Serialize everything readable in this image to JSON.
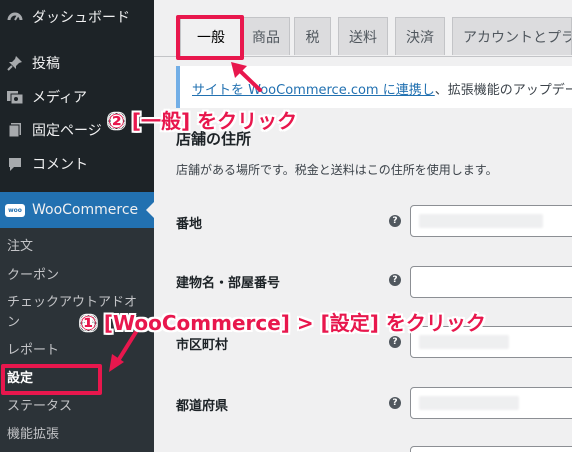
{
  "sidebar": {
    "items": [
      {
        "label": "ダッシュボード",
        "icon": "dashboard-icon"
      },
      {
        "label": "投稿",
        "icon": "pin-icon"
      },
      {
        "label": "メディア",
        "icon": "media-icon"
      },
      {
        "label": "固定ページ",
        "icon": "pages-icon"
      },
      {
        "label": "コメント",
        "icon": "comment-icon"
      }
    ],
    "woocommerce": {
      "label": "WooCommerce",
      "badge": "woo"
    },
    "submenu": [
      {
        "label": "注文"
      },
      {
        "label": "クーポン"
      },
      {
        "label": "チェックアウトアドオ"
      },
      {
        "label": "ン"
      },
      {
        "label": "レポート"
      },
      {
        "label": "設定"
      },
      {
        "label": "ステータス"
      },
      {
        "label": "機能拡張"
      }
    ]
  },
  "tabs": [
    {
      "label": "一般"
    },
    {
      "label": "商品"
    },
    {
      "label": "税"
    },
    {
      "label": "送料"
    },
    {
      "label": "決済"
    },
    {
      "label": "アカウントとプラ"
    }
  ],
  "notice": {
    "link_text": "サイトを WooCommerce.com に連携し",
    "rest_text": "、拡張機能のアップデート"
  },
  "section": {
    "title": "店舗の住所",
    "description": "店舗がある場所です。税金と送料はこの住所を使用します。"
  },
  "fields": [
    {
      "label": "番地",
      "help": "?"
    },
    {
      "label": "建物名・部屋番号",
      "help": "?"
    },
    {
      "label": "市区町村",
      "help": "?"
    },
    {
      "label": "都道府県",
      "help": "?"
    }
  ],
  "annotations": {
    "step2": "② [一般] をクリック",
    "step1": "① [WooCommerce] > [設定] をクリック"
  },
  "colors": {
    "accent": "#e8174d",
    "sidebar_bg": "#1d2327",
    "active_menu": "#2271b1",
    "link": "#2271b1"
  }
}
